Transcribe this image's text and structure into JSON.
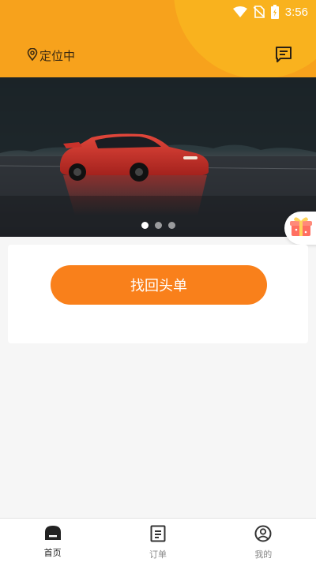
{
  "status_bar": {
    "time": "3:56",
    "icons": [
      "wifi-icon",
      "no-sim-icon",
      "battery-icon"
    ]
  },
  "header": {
    "location_text": "定位中",
    "message_icon": "message-icon"
  },
  "banner": {
    "image": "red-sports-car-photo",
    "slides": 3,
    "active_slide": 0
  },
  "floating": {
    "gift_icon": "gift-icon"
  },
  "card": {
    "primary_button_label": "找回头单"
  },
  "bottom_nav": {
    "items": [
      {
        "label": "首页",
        "icon": "home-icon",
        "active": true
      },
      {
        "label": "订单",
        "icon": "order-icon",
        "active": false
      },
      {
        "label": "我的",
        "icon": "profile-icon",
        "active": false
      }
    ]
  },
  "colors": {
    "header": "#f7a21c",
    "accent": "#f9801b",
    "background": "#f6f6f6"
  }
}
